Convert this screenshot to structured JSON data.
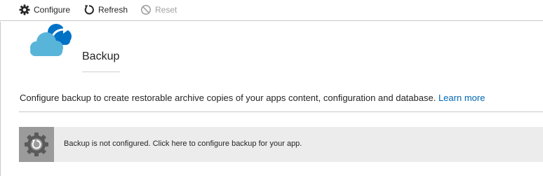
{
  "toolbar": {
    "configure_label": "Configure",
    "refresh_label": "Refresh",
    "reset_label": "Reset"
  },
  "header": {
    "title": "Backup"
  },
  "description": {
    "text": "Configure backup to create restorable archive copies of your apps content, configuration and database.",
    "link_label": "Learn more"
  },
  "notice": {
    "text": "Backup is not configured. Click here to configure backup for your app."
  },
  "icons": {
    "configure": "gear-icon",
    "refresh": "refresh-icon",
    "reset": "reset-icon",
    "backup": "cloud-backup-icon",
    "notice": "gear-refresh-icon"
  },
  "colors": {
    "link": "#0066b3",
    "cloud_light": "#59b4d9",
    "cloud_dark": "#0072c6",
    "notice_background": "#ececec",
    "notice_icon_background": "#9b9b9b",
    "disabled_text": "#a0a0a0"
  }
}
